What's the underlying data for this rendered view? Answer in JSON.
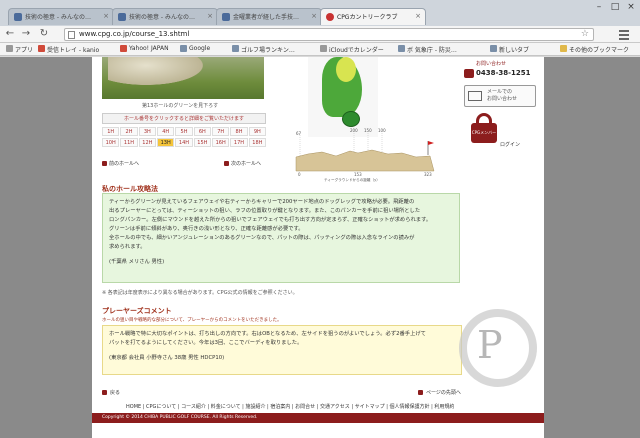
{
  "browser": {
    "tabs": [
      {
        "label": "技術の極意 - みんなの…"
      },
      {
        "label": "技術の極意 - みんなの…"
      },
      {
        "label": "金曜業者が経した手技…"
      },
      {
        "label": "CPGカントリークラブ"
      }
    ],
    "url": "www.cpg.co.jp/course_13.shtml",
    "bookmarks": [
      "アプリ",
      "受信トレイ - kanio",
      "Yahoo! JAPAN",
      "Google",
      "ゴルフ場ランキン…",
      "iCloudでカレンダー",
      "ボ 気象庁 - 防災…",
      "新しいタブ",
      "その他のブックマーク"
    ]
  },
  "page": {
    "caption": "第13ホールのグリーンを見下ろす",
    "hole_guide_header": "ホール番号をクリックすると詳細をご覧いただけます",
    "holes_row1": [
      "1H",
      "2H",
      "3H",
      "4H",
      "5H",
      "6H",
      "7H",
      "8H",
      "9H"
    ],
    "holes_row2": [
      "10H",
      "11H",
      "12H",
      "13H",
      "14H",
      "15H",
      "16H",
      "17H",
      "18H"
    ],
    "current_hole": "13H",
    "prev_link": "前のホールへ",
    "next_link": "次のホールへ",
    "profile": {
      "top_labels": [
        "67",
        "200",
        "150",
        "100"
      ],
      "bottom_labels": [
        "0",
        "153",
        "323"
      ],
      "caption": "ティーグラウンドからの距離（y）"
    },
    "side": {
      "tel_label": "お問い合わせ",
      "tel": "0438-38-1251",
      "mail_text1": "メールでの",
      "mail_text2": "お問い合わせ",
      "lock_label": "CPGメンバー",
      "lock_caption": "ログイン"
    },
    "section_title": "私のホール攻略法",
    "strategy_lines": [
      "ティーからグリーンが見えているフェアウェイや右ティーからキャリーで200ヤード地点のドッグレッグで攻略が必要。飛距離の",
      "出るプレーヤーにとっては、ティーショットの狙い、ラフの位置取りが鍵となります。また、このパンカーを手前に狙い場所とした",
      "ロングパンカー。左側にマウンドを越えた所からの狙いでフェアウェイでも打ち出す方向が定まらず、正確なショットが求められます。",
      "グリーンは手前に傾斜があり、奥行きの浅い形となり、正確な距離感が必要です。",
      "全ホールの中でも、細かいアンジュレーションのあるグリーンなので、パットの際は、パッティングの際は入念なラインの読みが",
      "求められます。",
      "(千葉県 メリさん 男性)"
    ],
    "note": "※ 各表記は年度表示により異なる場合があります。CPG公式の情報をご参照ください。",
    "players_title": "プレーヤーズコメント",
    "players_subnote": "ホールの狙い目や戦略的な部分について、プレーヤーからのコメントをいただきました。",
    "players_lines": [
      "ホール戦略で特に大切なポイントは、打ち出しの方向です。右はOBとなるため、左サイドを狙うのがよいでしょう。必ず2番手上げて",
      "パットを打てるようにしてください。今年は3回、ここでバーディを取りました。",
      "(東京都 会社員 小野寺さん 38歳 男性 HDCP10)"
    ],
    "back_left": "戻る",
    "back_right": "ページの先頭へ",
    "footer_nav": "HOME | CPGについて | コース紹介 | 料金について | 施設紹介 | 宿泊案内 | お問合せ | 交通アクセス | サイトマップ | 個人情報保護方針 | 利用規約",
    "copyright": "Copyright © 2014 CHIBA PUBLIC GOLF COURSE. All Rights Reserved."
  }
}
